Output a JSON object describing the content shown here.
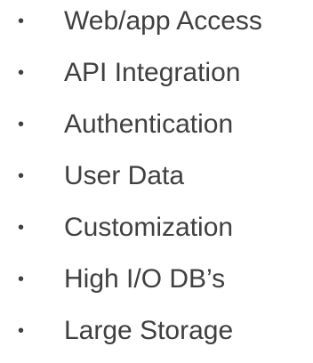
{
  "bullet_symbol": "•",
  "text_color": "#404040",
  "items": [
    {
      "label": "Web/app Access"
    },
    {
      "label": "API Integration"
    },
    {
      "label": "Authentication"
    },
    {
      "label": "User Data"
    },
    {
      "label": "Customization"
    },
    {
      "label": "High I/O DB’s"
    },
    {
      "label": "Large Storage"
    }
  ]
}
